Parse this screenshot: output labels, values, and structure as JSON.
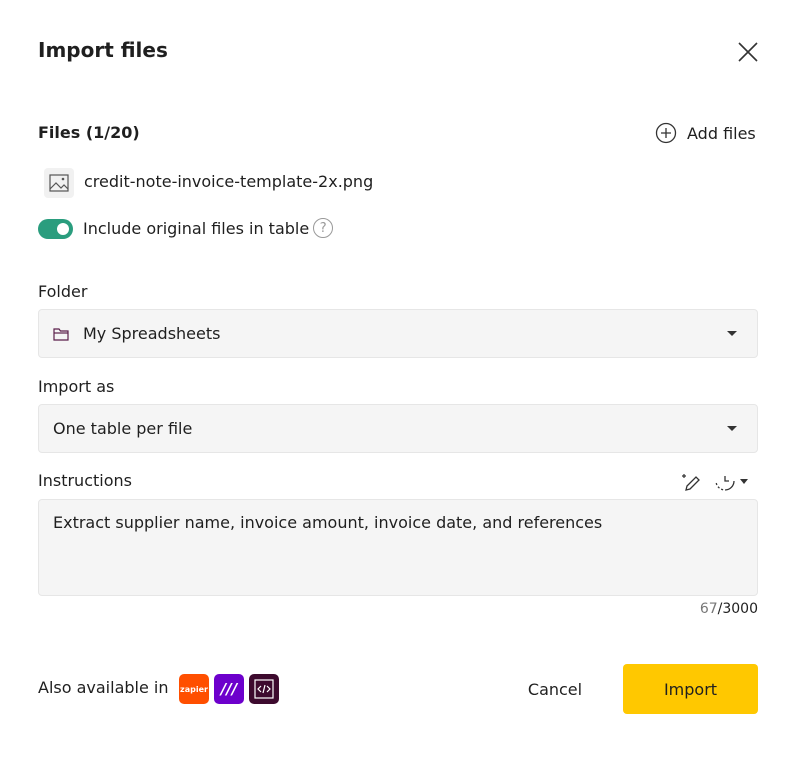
{
  "dialog": {
    "title": "Import files"
  },
  "files": {
    "heading": "Files (1/20)",
    "add_label": "Add files",
    "items": [
      {
        "name": "credit-note-invoice-template-2x.png",
        "icon": "image-icon"
      }
    ]
  },
  "toggle": {
    "label": "Include original files in table",
    "on": true
  },
  "folder": {
    "label": "Folder",
    "value": "My Spreadsheets"
  },
  "import_as": {
    "label": "Import as",
    "value": "One table per file"
  },
  "instructions": {
    "label": "Instructions",
    "value": "Extract supplier name, invoice amount, invoice date, and references",
    "count": "67",
    "max": "/3000"
  },
  "footer": {
    "also": "Also available in",
    "integrations": [
      {
        "name": "zapier",
        "label": "zapier",
        "color": "#ff4f00"
      },
      {
        "name": "make",
        "color": "#6d00cc"
      },
      {
        "name": "api",
        "color": "#3d0a2e"
      }
    ],
    "cancel": "Cancel",
    "import": "Import"
  },
  "colors": {
    "accent": "#ffc800",
    "toggle": "#2a9d7e"
  }
}
